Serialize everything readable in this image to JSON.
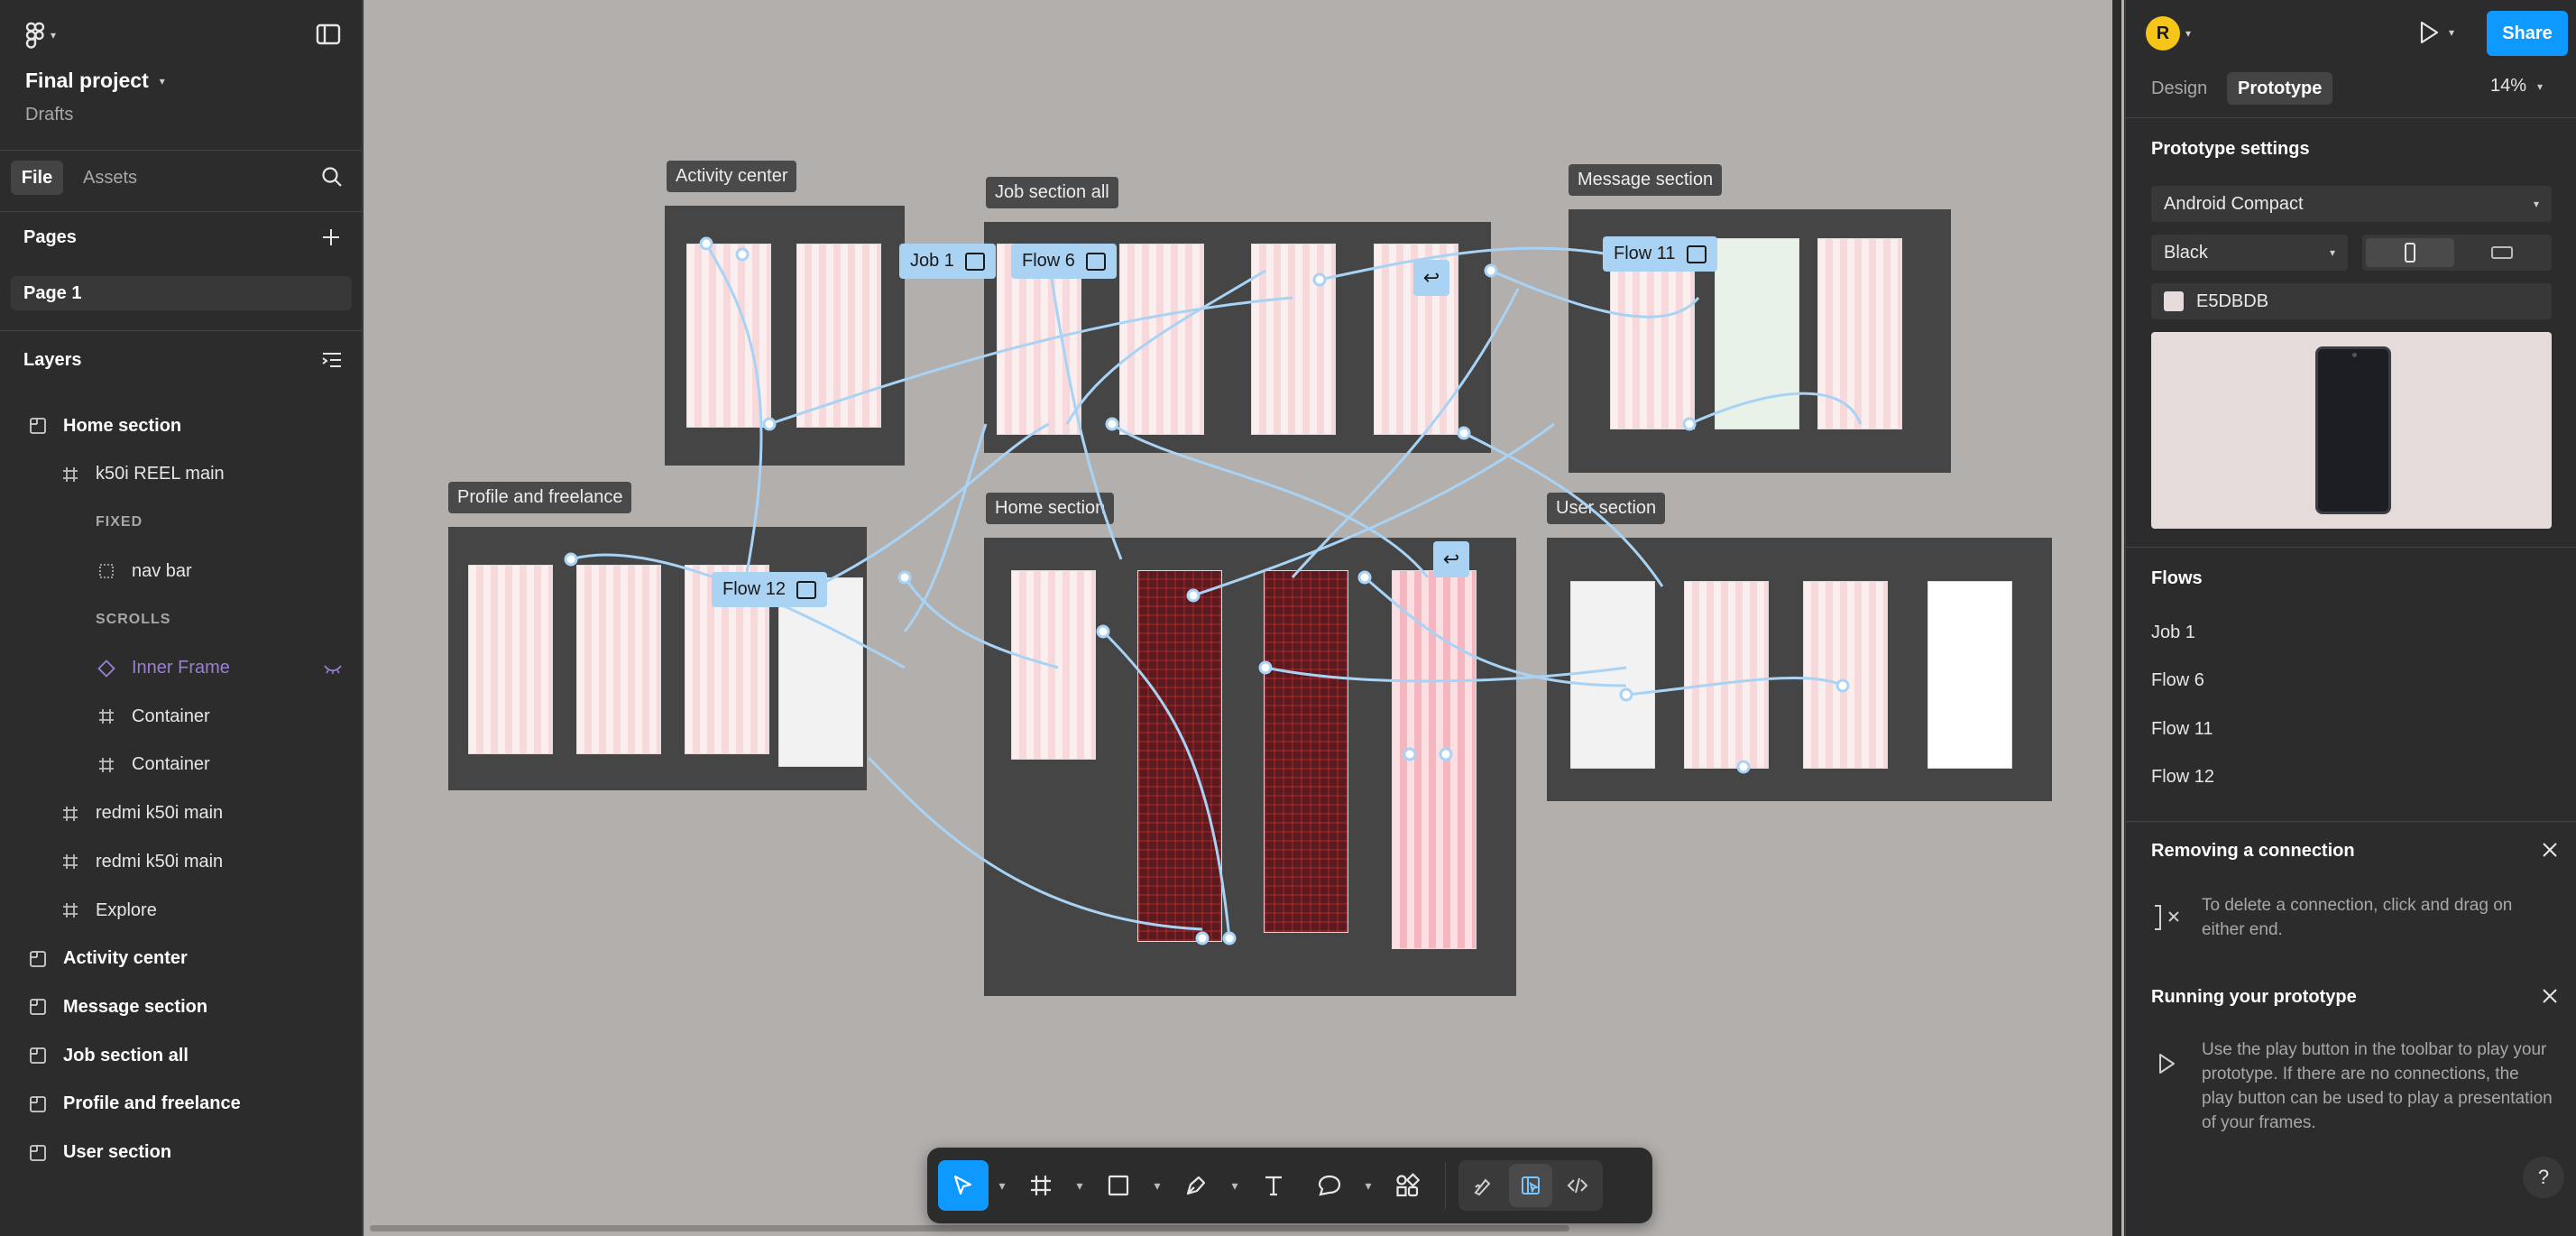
{
  "left_panel": {
    "file_name": "Final project",
    "location": "Drafts",
    "tabs": {
      "file": "File",
      "assets": "Assets"
    },
    "pages_heading": "Pages",
    "current_page": "Page 1",
    "layers_heading": "Layers",
    "layers": [
      {
        "label": "Home section",
        "kind": "section",
        "indent": 0
      },
      {
        "label": "k50i REEL main",
        "kind": "frame",
        "indent": 1
      },
      {
        "label": "FIXED",
        "kind": "group-heading",
        "indent": 2
      },
      {
        "label": "nav bar",
        "kind": "rect",
        "indent": 2
      },
      {
        "label": "SCROLLS",
        "kind": "group-heading",
        "indent": 2
      },
      {
        "label": "Inner Frame",
        "kind": "component",
        "indent": 2
      },
      {
        "label": "Container",
        "kind": "frame",
        "indent": 2
      },
      {
        "label": "Container",
        "kind": "frame",
        "indent": 2
      },
      {
        "label": "redmi k50i main",
        "kind": "frame",
        "indent": 1
      },
      {
        "label": "redmi k50i main",
        "kind": "frame",
        "indent": 1
      },
      {
        "label": "Explore",
        "kind": "frame",
        "indent": 1
      },
      {
        "label": "Activity center",
        "kind": "section",
        "indent": 0
      },
      {
        "label": "Message section",
        "kind": "section",
        "indent": 0
      },
      {
        "label": "Job section all",
        "kind": "section",
        "indent": 0
      },
      {
        "label": "Profile and freelance",
        "kind": "section",
        "indent": 0
      },
      {
        "label": "User section",
        "kind": "section",
        "indent": 0
      }
    ]
  },
  "canvas": {
    "sections": {
      "activity": "Activity center",
      "job": "Job section all",
      "message": "Message section",
      "profile": "Profile and freelance",
      "home": "Home section",
      "user": "User section"
    },
    "flow_tags": {
      "job1": "Job 1",
      "flow6": "Flow 6",
      "flow11": "Flow 11",
      "flow12": "Flow 12"
    },
    "wire_color": "#a9d3f5"
  },
  "toolbar": {
    "tools": [
      "move-icon",
      "frame-icon",
      "rectangle-icon",
      "pen-icon",
      "text-icon",
      "comment-icon",
      "actions-icon"
    ],
    "modes": [
      "draw-mode-icon",
      "design-mode-icon",
      "dev-mode-icon"
    ]
  },
  "right_panel": {
    "avatar_initial": "R",
    "share_label": "Share",
    "tabs": {
      "design": "Design",
      "prototype": "Prototype"
    },
    "zoom": "14%",
    "prototype_settings_heading": "Prototype settings",
    "device": "Android Compact",
    "device_color": "Black",
    "background_hex": "E5DBDB",
    "flows_heading": "Flows",
    "flows": [
      "Job 1",
      "Flow 6",
      "Flow 11",
      "Flow 12"
    ],
    "removing_heading": "Removing a connection",
    "removing_text": "To delete a connection, click and drag on either end.",
    "running_heading": "Running your prototype",
    "running_text": "Use the play button in the toolbar to play your prototype. If there are no connections, the play button can be used to play a presentation of your frames.",
    "help_label": "?"
  },
  "colors": {
    "accent": "#0d99ff",
    "canvas_bg": "#b3afad",
    "panel_bg": "#2c2c2c",
    "section_bg": "#454545",
    "prototype_bg": "#E5DBDB",
    "avatar": "#f5c518"
  }
}
